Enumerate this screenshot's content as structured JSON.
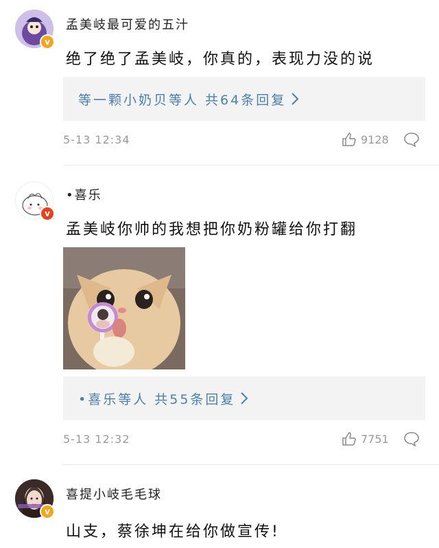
{
  "comments": [
    {
      "username": "孟美岐最可爱的五汁",
      "text": "绝了绝了孟美岐，你真的，表现力没的说",
      "reply": "等一颗小奶贝等人 共64条回复",
      "time": "5-13 12:34",
      "likes": "9128",
      "badge": "v"
    },
    {
      "username": "•喜乐",
      "text": "孟美岐你帅的我想把你奶粉罐给你打翻",
      "reply": "•喜乐等人 共55条回复",
      "time": "5-13 12:32",
      "likes": "7751",
      "badge": "v"
    },
    {
      "username": "喜提小岐毛毛球",
      "text": "山支，蔡徐坤在给你做宣传!",
      "badge": "v"
    }
  ],
  "icons": {
    "like": "thumbs-up-icon",
    "comment": "comment-bubble-icon",
    "chevron": "chevron-right-icon"
  },
  "colors": {
    "link": "#4a7fb0",
    "meta": "#9a9a9a",
    "badge": "#f4a51a",
    "reply_bg": "#f3f3f3"
  }
}
